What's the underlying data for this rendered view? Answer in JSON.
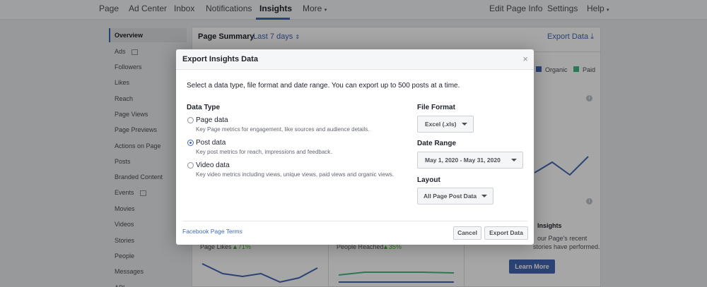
{
  "topnav": {
    "left": [
      "Page",
      "Ad Center",
      "Inbox",
      "Notifications",
      "Insights",
      "More"
    ],
    "right": [
      "Edit Page Info",
      "Settings",
      "Help"
    ],
    "active": "Insights"
  },
  "sidebar": {
    "items": [
      "Overview",
      "Ads",
      "Followers",
      "Likes",
      "Reach",
      "Page Views",
      "Page Previews",
      "Actions on Page",
      "Posts",
      "Branded Content",
      "Events",
      "Movies",
      "Videos",
      "Stories",
      "People",
      "Messages",
      "API"
    ],
    "active": "Overview"
  },
  "summary": {
    "title": "Page Summary",
    "range": "Last 7 days",
    "export": "Export Data",
    "legend": [
      {
        "label": "Organic",
        "color": "#4267b2"
      },
      {
        "label": "Paid",
        "color": "#42b883"
      }
    ],
    "page_likes_label": "Page Likes",
    "page_likes_delta": "71%",
    "people_reached_label": "People Reached",
    "people_reached_delta": "35%",
    "insights_heading": "Insights",
    "insights_text1": "our Page's recent",
    "insights_text2": "stories have performed.",
    "learn_more": "Learn More"
  },
  "dialog": {
    "title": "Export Insights Data",
    "description": "Select a data type, file format and date range. You can export up to 500 posts at a time.",
    "data_type_label": "Data Type",
    "options": [
      {
        "label": "Page data",
        "sub": "Key Page metrics for engagement, like sources and audience details.",
        "checked": false
      },
      {
        "label": "Post data",
        "sub": "Key post metrics for reach, impressions and feedback.",
        "checked": true
      },
      {
        "label": "Video data",
        "sub": "Key video metrics including views, unique views, paid views and organic views.",
        "checked": false
      }
    ],
    "file_format_label": "File Format",
    "file_format_value": "Excel (.xls)",
    "date_range_label": "Date Range",
    "date_range_value": "May 1, 2020 - May 31, 2020",
    "layout_label": "Layout",
    "layout_value": "All Page Post Data",
    "terms": "Facebook Page Terms",
    "cancel": "Cancel",
    "export": "Export Data"
  }
}
